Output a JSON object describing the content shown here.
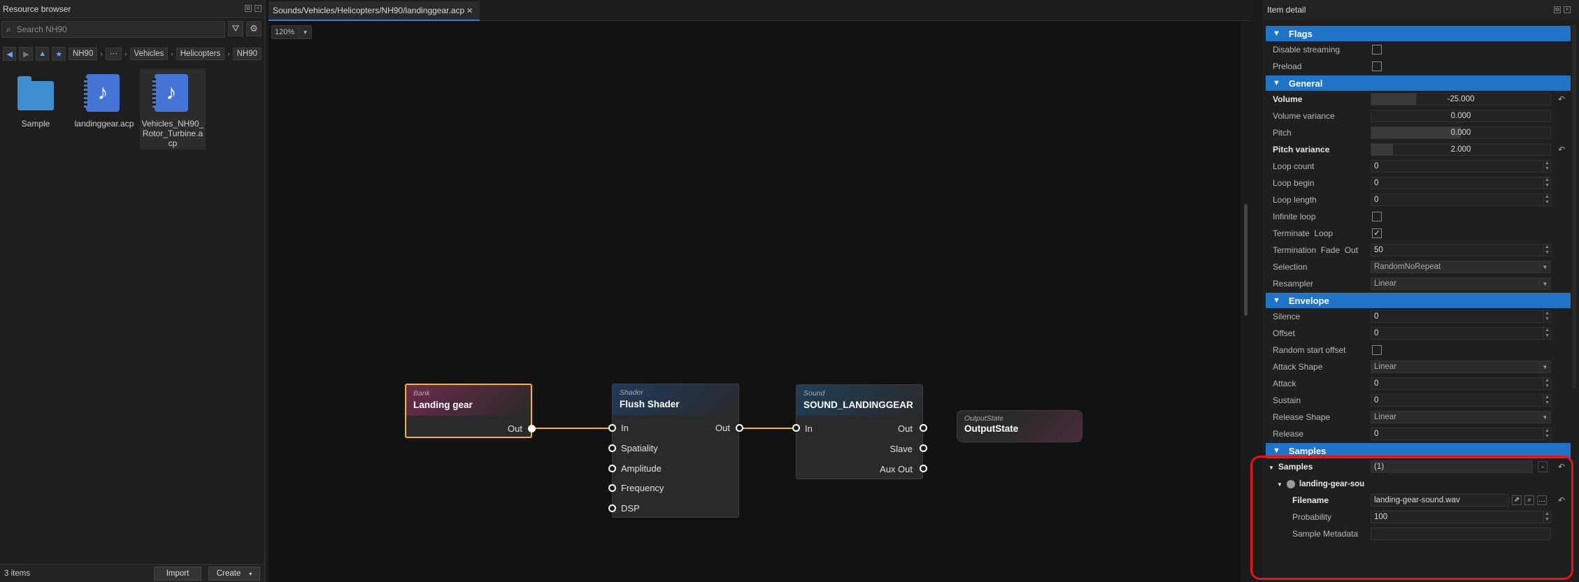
{
  "left_panel": {
    "title": "Resource browser",
    "search_placeholder": "Search NH90",
    "breadcrumb": [
      "NH90",
      "···",
      "Vehicles",
      "Helicopters",
      "NH90"
    ],
    "files": [
      {
        "name": "Sample",
        "type": "folder"
      },
      {
        "name": "landinggear.acp",
        "type": "audio"
      },
      {
        "name": "Vehicles_NH90_\nRotor_Turbine.a\ncp",
        "type": "audio"
      }
    ],
    "item_count": "3 items",
    "import_label": "Import",
    "create_label": "Create"
  },
  "editor": {
    "tab_title": "Sounds/Vehicles/Helicopters/NH90/landinggear.acp",
    "zoom": "120%",
    "nodes": {
      "bank": {
        "type": "Bank",
        "title": "Landing gear",
        "out": "Out"
      },
      "shader": {
        "type": "Shader",
        "title": "Flush Shader",
        "inputs": [
          "In",
          "Spatiality",
          "Amplitude",
          "Frequency",
          "DSP"
        ],
        "out": "Out"
      },
      "sound": {
        "type": "Sound",
        "title": "SOUND_LANDINGGEAR",
        "in": "In",
        "outputs": [
          "Out",
          "Slave",
          "Aux Out"
        ]
      },
      "output": {
        "type": "OutputState",
        "title": "OutputState"
      }
    }
  },
  "item_detail": {
    "title": "Item detail",
    "flags": {
      "header": "Flags",
      "disable_streaming": "Disable streaming",
      "preload": "Preload"
    },
    "general": {
      "header": "General",
      "volume_label": "Volume",
      "volume": "-25.000",
      "volume_fraction": 0.25,
      "volume_variance_label": "Volume variance",
      "volume_variance": "0.000",
      "pitch_label": "Pitch",
      "pitch": "0.000",
      "pitch_fraction": 0.5,
      "pitch_variance_label": "Pitch variance",
      "pitch_variance": "2.000",
      "pitch_variance_fraction": 0.12,
      "loop_count_label": "Loop count",
      "loop_count": "0",
      "loop_begin_label": "Loop begin",
      "loop_begin": "0",
      "loop_length_label": "Loop length",
      "loop_length": "0",
      "infinite_loop_label": "Infinite loop",
      "terminate_loop_label": "Terminate  Loop",
      "terminate_loop_checked": true,
      "termination_fade_out_label": "Termination  Fade  Out",
      "termination_fade_out": "50",
      "selection_label": "Selection",
      "selection": "RandomNoRepeat",
      "resampler_label": "Resampler",
      "resampler": "Linear"
    },
    "envelope": {
      "header": "Envelope",
      "silence_label": "Silence",
      "silence": "0",
      "offset_label": "Offset",
      "offset": "0",
      "random_start_offset_label": "Random start offset",
      "attack_shape_label": "Attack Shape",
      "attack_shape": "Linear",
      "attack_label": "Attack",
      "attack": "0",
      "sustain_label": "Sustain",
      "sustain": "0",
      "release_shape_label": "Release Shape",
      "release_shape": "Linear",
      "release_label": "Release",
      "release": "0"
    },
    "samples": {
      "header": "Samples",
      "samples_label": "Samples",
      "samples_count": "(1)",
      "sample_name": "landing-gear-sou",
      "filename_label": "Filename",
      "filename": "landing-gear-sound.wav",
      "probability_label": "Probability",
      "probability": "100",
      "metadata_label": "Sample Metadata"
    }
  },
  "colors": {
    "accent": "#1f74c8",
    "highlight": "#e8121a",
    "wire": "#f2b430"
  }
}
